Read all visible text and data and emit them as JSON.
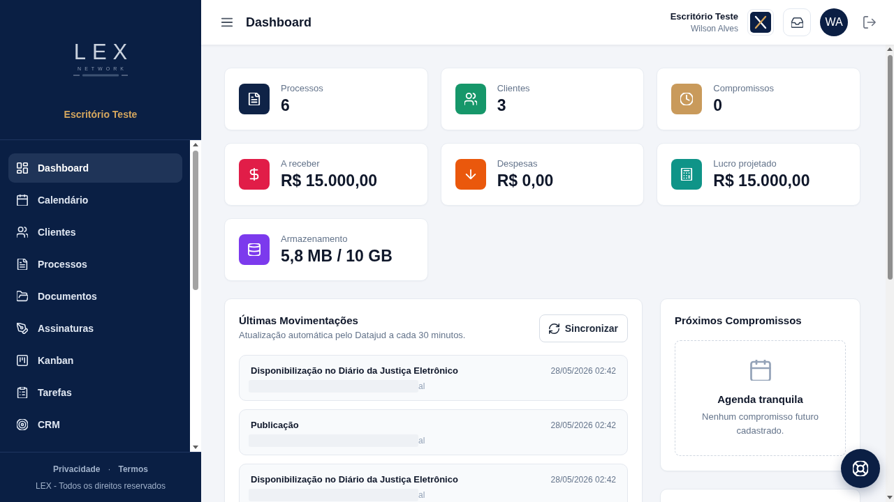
{
  "sidebar": {
    "logo": {
      "wordmark": "LEX",
      "subtitle": "NETWORK"
    },
    "office": "Escritório Teste",
    "items": [
      {
        "label": "Dashboard",
        "selected": true
      },
      {
        "label": "Calendário",
        "selected": false
      },
      {
        "label": "Clientes",
        "selected": false
      },
      {
        "label": "Processos",
        "selected": false
      },
      {
        "label": "Documentos",
        "selected": false
      },
      {
        "label": "Assinaturas",
        "selected": false
      },
      {
        "label": "Kanban",
        "selected": false
      },
      {
        "label": "Tarefas",
        "selected": false
      },
      {
        "label": "CRM",
        "selected": false
      }
    ],
    "footer": {
      "links": [
        "Privacidade",
        "Termos"
      ],
      "separator": "·",
      "copyright": "LEX - Todos os direitos reservados"
    }
  },
  "header": {
    "title": "Dashboard",
    "office": "Escritório Teste",
    "user": "Wilson Alves",
    "avatar_initials": "WA"
  },
  "stats": [
    {
      "label": "Processos",
      "value": "6",
      "color": "#0f2347"
    },
    {
      "label": "Clientes",
      "value": "3",
      "color": "#16976a"
    },
    {
      "label": "Compromissos",
      "value": "0",
      "color": "#c99a5b"
    },
    {
      "label": "A receber",
      "value": "R$ 15.000,00",
      "color": "#e11d48"
    },
    {
      "label": "Despesas",
      "value": "R$ 0,00",
      "color": "#ea580c"
    },
    {
      "label": "Lucro projetado",
      "value": "R$ 15.000,00",
      "color": "#0f9488"
    },
    {
      "label": "Armazenamento",
      "value": "5,8 MB / 10 GB",
      "color": "#7c3aed"
    }
  ],
  "movements": {
    "title": "Últimas Movimentações",
    "subtitle": "Atualização automática pelo Datajud a cada 30 minutos.",
    "sync_button": "Sincronizar",
    "items": [
      {
        "title": "Disponibilização no Diário da Justiça Eletrônico",
        "date": "28/05/2026 02:42",
        "detail": "al"
      },
      {
        "title": "Publicação",
        "date": "28/05/2026 02:42",
        "detail": "al"
      },
      {
        "title": "Disponibilização no Diário da Justiça Eletrônico",
        "date": "28/05/2026 02:42",
        "detail": "al"
      }
    ]
  },
  "upcoming": {
    "title": "Próximos Compromissos",
    "empty_title": "Agenda tranquila",
    "empty_text": "Nenhum compromisso futuro cadastrado."
  }
}
